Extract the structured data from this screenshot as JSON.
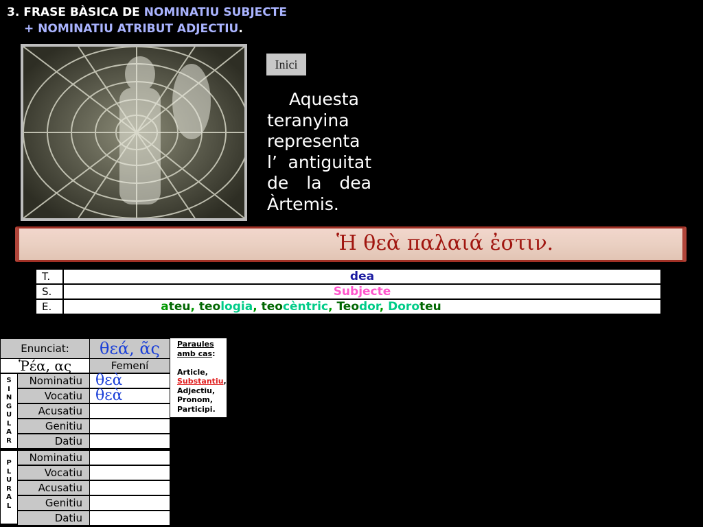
{
  "title": {
    "line1_prefix": "3. FRASE BÀSICA DE ",
    "line1_highlight": "NOMINATIU SUBJECTE",
    "line2_highlight": "+ NOMINATIU ATRIBUT ADJECTIU",
    "line2_suffix": "."
  },
  "image": {
    "icon": "spiderweb-statue-image"
  },
  "inici_label": "Inici",
  "description": "Aquesta teranyina representa l’ antiguitat de la dea Àrtemis.",
  "scroll_sentence": "Ἡ θεὰ παλαιά ἐστιν.",
  "tse": {
    "t_label": "T.",
    "t_value": "dea",
    "s_label": "S.",
    "s_value": "Subjecte",
    "e_label": "E.",
    "e_parts": [
      {
        "text": "a",
        "color": "#009900"
      },
      {
        "text": "teu",
        "color": "#006600"
      },
      {
        "text": ", ",
        "color": "#009900"
      },
      {
        "text": "teo",
        "color": "#006600"
      },
      {
        "text": "logia",
        "color": "#00cc88"
      },
      {
        "text": ", ",
        "color": "#009900"
      },
      {
        "text": "teo",
        "color": "#006600"
      },
      {
        "text": "cèntric",
        "color": "#00cc88"
      },
      {
        "text": ", ",
        "color": "#009900"
      },
      {
        "text": "Teo",
        "color": "#006600"
      },
      {
        "text": "dor",
        "color": "#00cc88"
      },
      {
        "text": ", ",
        "color": "#009900"
      },
      {
        "text": "Doro",
        "color": "#00cc88"
      },
      {
        "text": "teu",
        "color": "#006600"
      }
    ]
  },
  "declension": {
    "enunciat_label": "Enunciat:",
    "enunciat_value": "θεά, ᾶς",
    "decl_label": "Ῥέα, ας",
    "gender": "Femení",
    "singular_label": "SINGULAR",
    "plural_label": "PLURAL",
    "singular": [
      {
        "case": "Nominatiu",
        "form": "θεὰ"
      },
      {
        "case": "Vocatiu",
        "form": "θεὰ"
      },
      {
        "case": "Acusatiu",
        "form": ""
      },
      {
        "case": "Genitiu",
        "form": ""
      },
      {
        "case": "Datiu",
        "form": ""
      }
    ],
    "plural": [
      {
        "case": "Nominatiu",
        "form": ""
      },
      {
        "case": "Vocatiu",
        "form": ""
      },
      {
        "case": "Acusatiu",
        "form": ""
      },
      {
        "case": "Genitiu",
        "form": ""
      },
      {
        "case": "Datiu",
        "form": ""
      }
    ]
  },
  "info": {
    "heading1": "Paraules",
    "heading2": "amb cas",
    "heading_colon": ":",
    "items": [
      "Article,",
      "Substantiu",
      ",",
      "Adjectiu,",
      "Pronom,",
      "Participi."
    ]
  },
  "colors": {
    "title_highlight": "#aab4ff",
    "scroll_text": "#a0150f",
    "greek_forms": "#1a3fd8",
    "red_ending": "#e02020"
  }
}
